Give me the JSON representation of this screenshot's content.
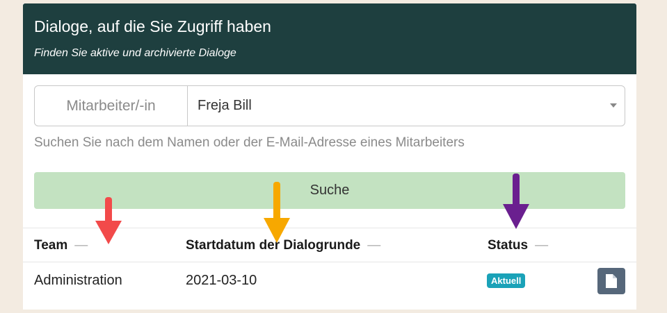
{
  "header": {
    "title": "Dialoge, auf die Sie Zugriff haben",
    "subtitle": "Finden Sie aktive und archivierte Dialoge"
  },
  "employee_select": {
    "addon_label": "Mitarbeiter/-in",
    "selected_value": "Freja Bill",
    "help_text": "Suchen Sie nach dem Namen oder der E-Mail-Adresse eines Mitarbeiters"
  },
  "search_button": {
    "label": "Suche"
  },
  "table": {
    "columns": [
      {
        "label": "Team",
        "sort_indicator": "—"
      },
      {
        "label": "Startdatum der Dialogrunde",
        "sort_indicator": "—"
      },
      {
        "label": "Status",
        "sort_indicator": "—"
      }
    ],
    "rows": [
      {
        "team": "Administration",
        "start_date": "2021-03-10",
        "status": "Aktuell",
        "action_icon": "document-icon"
      }
    ]
  },
  "annotations": {
    "arrow_colors": [
      "#f24a4a",
      "#f7a800",
      "#6a1f8f"
    ]
  },
  "colors": {
    "header_bg": "#1e3f3f",
    "search_button_bg": "#c3e2c1",
    "status_badge_bg": "#1aa2b8",
    "action_button_bg": "#56677a",
    "page_bg": "#f3ebe1"
  }
}
